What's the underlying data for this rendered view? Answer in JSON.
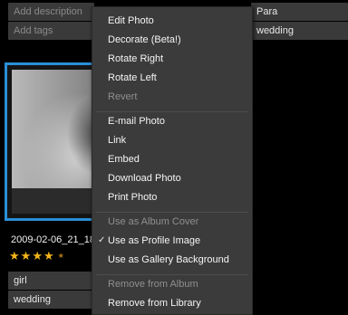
{
  "details": {
    "description_placeholder": "Add description",
    "tags_placeholder": "Add tags",
    "tag_right_1": "Para",
    "tag_right_2": "wedding"
  },
  "photo": {
    "filename": "2009-02-06_21_18_",
    "rating": 4,
    "rating_max": 5,
    "tags": [
      "girl",
      "wedding"
    ]
  },
  "context_menu": {
    "edit_photo": "Edit Photo",
    "decorate": "Decorate (Beta!)",
    "rotate_right": "Rotate Right",
    "rotate_left": "Rotate Left",
    "revert": "Revert",
    "email_photo": "E-mail Photo",
    "link": "Link",
    "embed": "Embed",
    "download_photo": "Download Photo",
    "print_photo": "Print Photo",
    "use_as_album_cover": "Use as Album Cover",
    "use_as_profile_image": "Use as Profile Image",
    "use_as_gallery_background": "Use as Gallery Background",
    "remove_from_album": "Remove from Album",
    "remove_from_library": "Remove from Library",
    "checked_item": "use_as_profile_image"
  },
  "colors": {
    "selection_border": "#2a8fd6",
    "star": "#f3b41c"
  }
}
